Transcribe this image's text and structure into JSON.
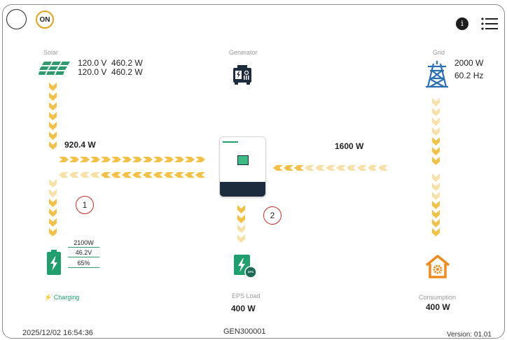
{
  "header": {
    "power_status": "ON",
    "info_icon": "info-icon",
    "menu_icon": "hamburger-menu-icon"
  },
  "solar": {
    "label": "Solar",
    "line1": "120.0 V  460.2 W",
    "line2": "120.0 V  460.2 W",
    "flow_power": "920.4 W"
  },
  "generator": {
    "label": "Generator"
  },
  "grid": {
    "label": "Grid",
    "power": "2000 W",
    "frequency": "60.2 Hz",
    "flow_power": "1600 W"
  },
  "battery": {
    "power": "2100W",
    "voltage": "46.2V",
    "soc": "65%",
    "status": "Charging",
    "marker": "1"
  },
  "eps": {
    "label": "EPS Load",
    "power": "400 W",
    "marker": "2",
    "badge": "EPS"
  },
  "consumption": {
    "label": "Consumption",
    "power": "400 W"
  },
  "footer": {
    "timestamp": "2025/12/02 16:54:36",
    "serial": "GEN300001",
    "version": "Version: 01.01"
  },
  "colors": {
    "arrow_strong": "#f2c146",
    "arrow_light": "#f7e1a8",
    "green": "#1f9e6e",
    "orange": "#f08a1c",
    "blue": "#2a6fb5",
    "marker_red": "#c82828"
  }
}
